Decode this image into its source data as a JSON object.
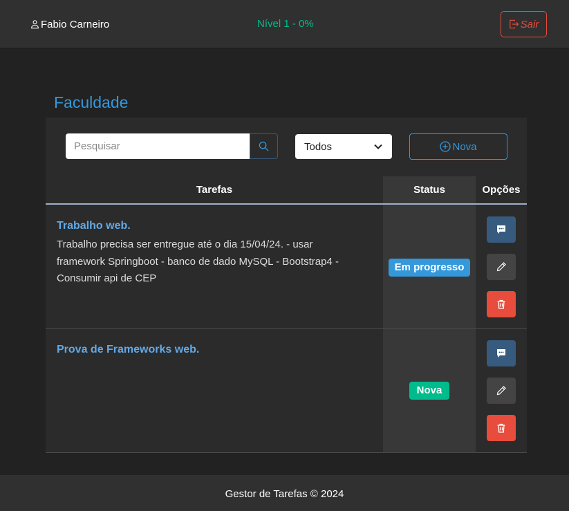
{
  "header": {
    "user_name": "Fabio Carneiro",
    "level": "Nível 1 - 0%",
    "logout_label": "Sair"
  },
  "section": {
    "title": "Faculdade"
  },
  "toolbar": {
    "search_placeholder": "Pesquisar",
    "filter_selected": "Todos",
    "new_label": "Nova"
  },
  "table": {
    "columns": [
      "Tarefas",
      "Status",
      "Opções"
    ],
    "rows": [
      {
        "title": "Trabalho web.",
        "description": "Trabalho precisa ser entregue até o dia 15/04/24. - usar framework Springboot - banco de dado MySQL - Bootstrap4 - Consumir api de CEP",
        "status": "Em progresso"
      },
      {
        "title": "Prova de Frameworks web.",
        "description": "",
        "status": "Nova"
      }
    ]
  },
  "footer": {
    "text": "Gestor de Tarefas © 2024"
  },
  "colors": {
    "background": "#222222",
    "accent_blue": "#3498db",
    "success_green": "#00bc8c",
    "danger_red": "#e74c3c"
  }
}
